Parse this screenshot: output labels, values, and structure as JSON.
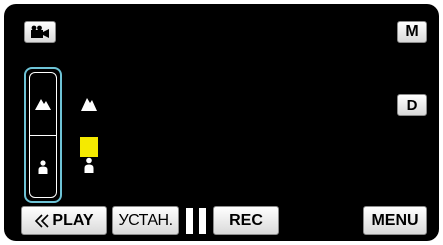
{
  "top": {
    "camera_icon": "movie-camera-icon",
    "manual_label": "M"
  },
  "focus": {
    "far_icon": "mountain-icon",
    "near_icon": "person-icon",
    "level": 0.5,
    "level_color": "#f5ea00",
    "highlight_color": "#6ec3d6"
  },
  "side": {
    "display_label": "D"
  },
  "bottom": {
    "play_label": "PLAY",
    "play_icon": "double-chevron-left-icon",
    "setup_label": "УСТАН.",
    "pause_icon": "pause-icon",
    "rec_label": "REC",
    "menu_label": "MENU"
  }
}
